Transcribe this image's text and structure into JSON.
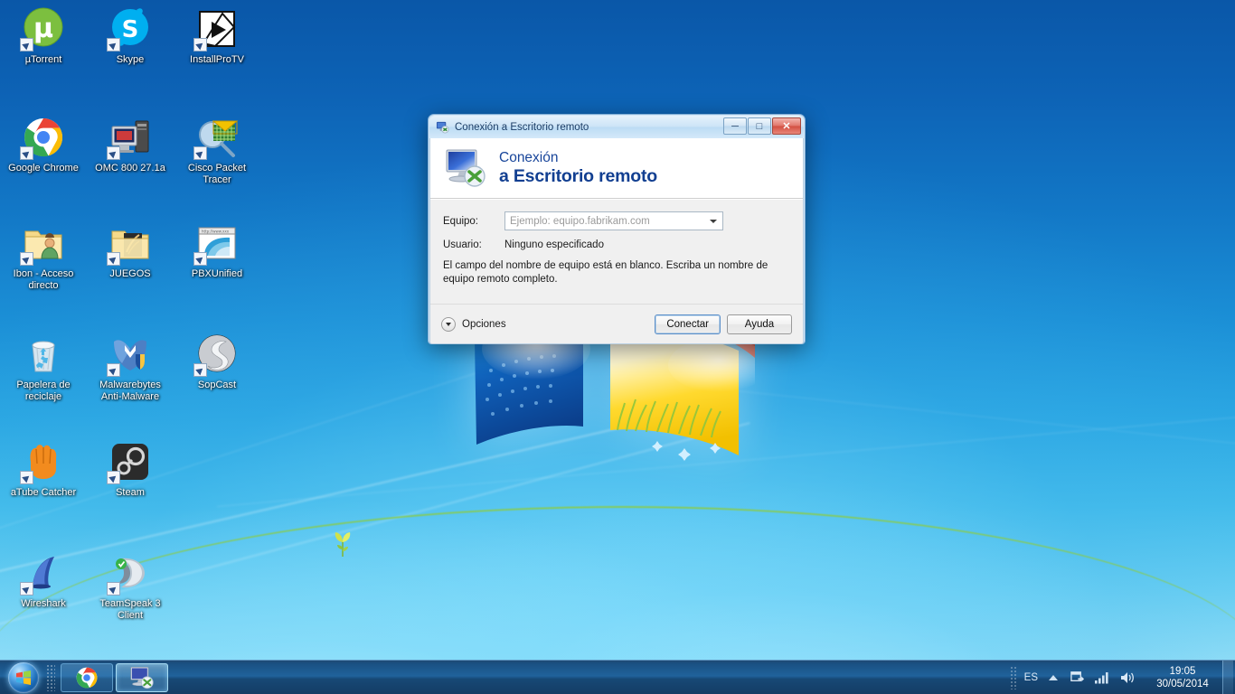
{
  "desktop": {
    "icons": [
      {
        "label": "µTorrent",
        "icon": "utorrent-icon",
        "col": 0,
        "row": 0
      },
      {
        "label": "Skype",
        "icon": "skype-icon",
        "col": 1,
        "row": 0
      },
      {
        "label": "InstallProTV",
        "icon": "installprotv-icon",
        "col": 2,
        "row": 0
      },
      {
        "label": "Google Chrome",
        "icon": "chrome-icon",
        "col": 0,
        "row": 1
      },
      {
        "label": "OMC 800 27.1a",
        "icon": "computer-icon",
        "col": 1,
        "row": 1
      },
      {
        "label": "Cisco Packet Tracer",
        "icon": "packet-tracer-icon",
        "col": 2,
        "row": 1
      },
      {
        "label": "Ibon - Acceso directo",
        "icon": "user-folder-icon",
        "col": 0,
        "row": 2
      },
      {
        "label": "JUEGOS",
        "icon": "folder-icon",
        "col": 1,
        "row": 2
      },
      {
        "label": "PBXUnified",
        "icon": "web-shortcut-icon",
        "col": 2,
        "row": 2
      },
      {
        "label": "Papelera de reciclaje",
        "icon": "recycle-bin-icon",
        "col": 0,
        "row": 3
      },
      {
        "label": "Malwarebytes Anti-Malware",
        "icon": "malwarebytes-icon",
        "col": 1,
        "row": 3
      },
      {
        "label": "SopCast",
        "icon": "sopcast-icon",
        "col": 2,
        "row": 3
      },
      {
        "label": "aTube Catcher",
        "icon": "atube-catcher-icon",
        "col": 0,
        "row": 4
      },
      {
        "label": "Steam",
        "icon": "steam-icon",
        "col": 1,
        "row": 4
      },
      {
        "label": "Wireshark",
        "icon": "wireshark-icon",
        "col": 0,
        "row": 5
      },
      {
        "label": "TeamSpeak 3 Client",
        "icon": "teamspeak-icon",
        "col": 1,
        "row": 5
      }
    ]
  },
  "dialog": {
    "title": "Conexión a Escritorio remoto",
    "title_icon": "remote-desktop-icon",
    "window_buttons": {
      "minimize": "─",
      "maximize": "□",
      "close": "✕"
    },
    "header": {
      "line1": "Conexión",
      "line2": "a Escritorio remoto",
      "icon": "remote-desktop-monitor-icon"
    },
    "fields": {
      "computer_label": "Equipo:",
      "computer_placeholder": "Ejemplo: equipo.fabrikam.com",
      "computer_value": "",
      "user_label": "Usuario:",
      "user_value": "Ninguno especificado"
    },
    "warning": "El campo del nombre de equipo está en blanco. Escriba un nombre de equipo remoto completo.",
    "footer": {
      "options_label": "Opciones",
      "connect_label": "Conectar",
      "help_label": "Ayuda"
    }
  },
  "taskbar": {
    "start_name": "start-orb",
    "buttons": [
      {
        "label": "Google Chrome",
        "icon": "chrome-icon",
        "active": false
      },
      {
        "label": "Conexión a Escritorio remoto",
        "icon": "remote-desktop-icon",
        "active": true
      }
    ],
    "tray": {
      "language": "ES",
      "show_hidden_icons": "show-hidden-icons",
      "icons": [
        "action-center-icon",
        "network-signal-icon",
        "volume-icon"
      ],
      "time": "19:05",
      "date": "30/05/2014"
    }
  },
  "colors": {
    "desktop_top": "#0a57a8",
    "desktop_bottom": "#9ee4f8",
    "taskbar": "#1a5c96",
    "dialog_header_text": "#123f91",
    "dialog_body": "#f0f0f0",
    "placeholder_text": "#9b9b9b"
  }
}
